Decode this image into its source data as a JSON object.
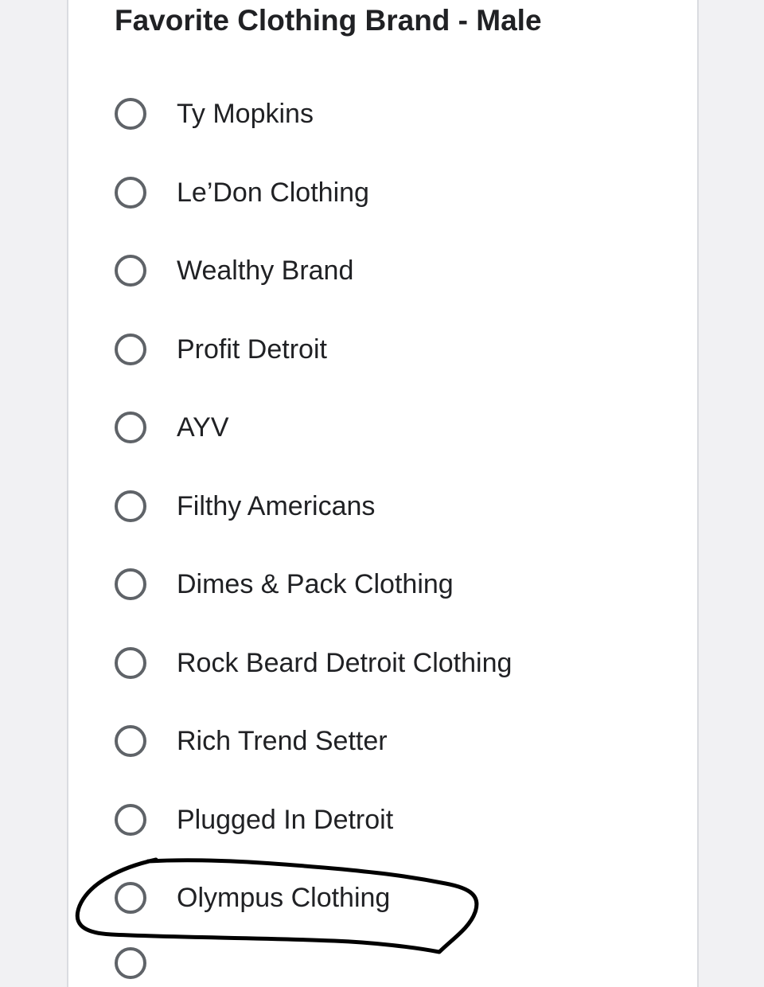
{
  "question": {
    "title": "Favorite Clothing Brand - Male"
  },
  "options": [
    {
      "label": "Ty Mopkins",
      "selected": false
    },
    {
      "label": "Le’Don Clothing",
      "selected": false
    },
    {
      "label": "Wealthy Brand",
      "selected": false
    },
    {
      "label": "Profit Detroit",
      "selected": false
    },
    {
      "label": "AYV",
      "selected": false
    },
    {
      "label": "Filthy Americans",
      "selected": false
    },
    {
      "label": "Dimes & Pack Clothing",
      "selected": false
    },
    {
      "label": "Rock Beard Detroit Clothing",
      "selected": false
    },
    {
      "label": "Rich Trend Setter",
      "selected": false
    },
    {
      "label": "Plugged In Detroit",
      "selected": false
    },
    {
      "label": "Olympus Clothing",
      "selected": false
    }
  ],
  "annotation": {
    "type": "hand-drawn-circle",
    "target_option": "Olympus Clothing",
    "color": "#000000"
  },
  "colors": {
    "background": "#f1f1f3",
    "card": "#ffffff",
    "radio_border": "#5f6368",
    "text": "#202124"
  }
}
